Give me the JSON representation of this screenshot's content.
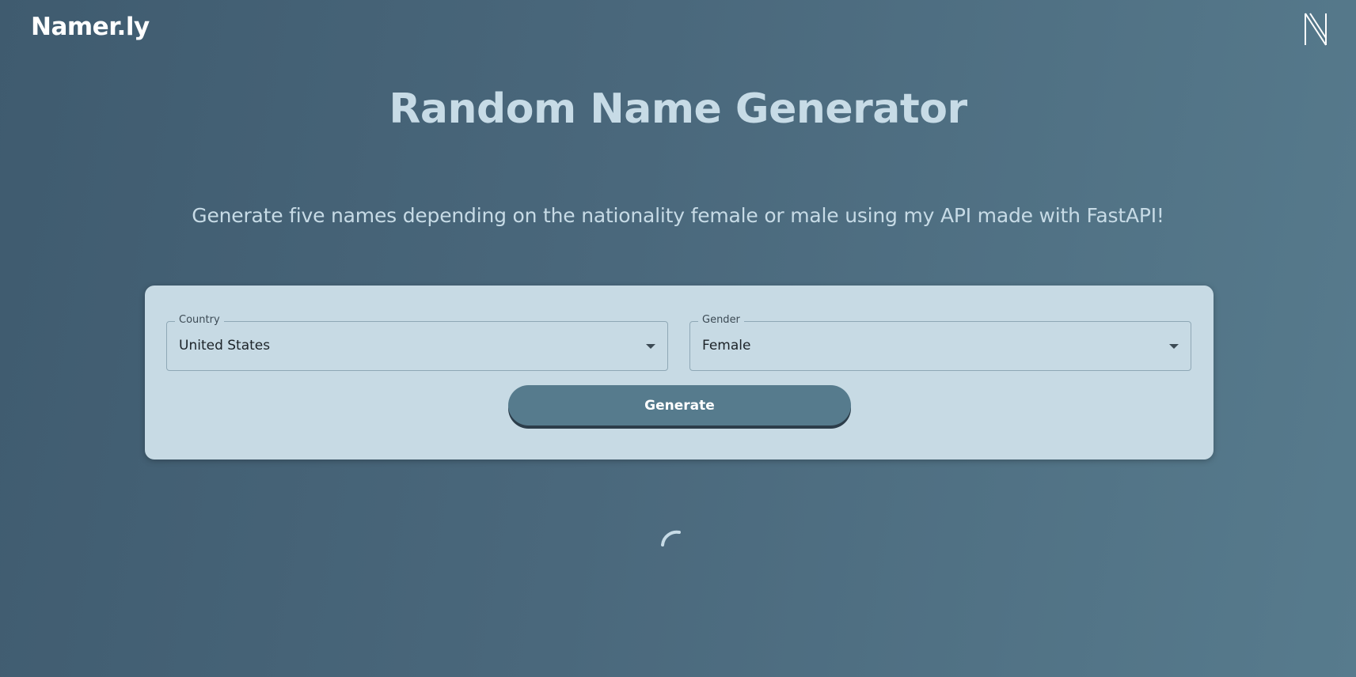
{
  "header": {
    "brand": "Namer.ly",
    "logo_icon": "n-logo-icon"
  },
  "main": {
    "title": "Random Name Generator",
    "subtitle": "Generate five names depending on the nationality female or male using my API made with FastAPI!"
  },
  "form": {
    "country": {
      "label": "Country",
      "value": "United States"
    },
    "gender": {
      "label": "Gender",
      "value": "Female"
    },
    "generate_label": "Generate"
  },
  "status": {
    "loading_icon": "loading-spinner-icon"
  },
  "colors": {
    "background_start": "#3f5b6f",
    "background_end": "#577b8d",
    "card": "#c7dae4",
    "button": "#567b8d",
    "text_light": "#c7dbe6"
  }
}
